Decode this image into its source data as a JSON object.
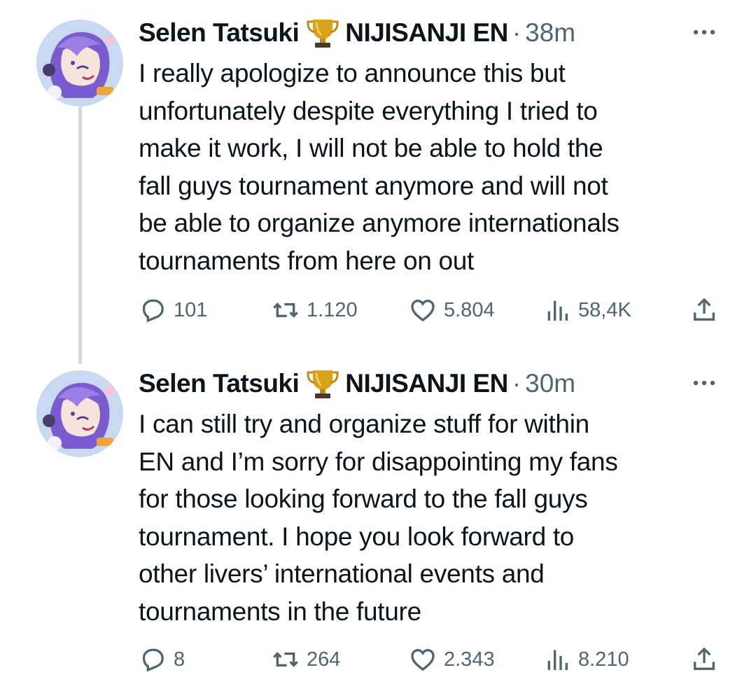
{
  "tweets": [
    {
      "display_name": "Selen Tatsuki",
      "badge_icon": "trophy-icon",
      "affiliation": "NIJISANJI EN",
      "separator": "·",
      "time": "38m",
      "text_lines": [
        "I really apologize to announce this but",
        "unfortunately despite everything I tried to",
        "make it work, I will not be able to hold the",
        "fall guys tournament anymore and will not",
        "be able to organize anymore internationals",
        "tournaments from here on out"
      ],
      "replies": "101",
      "reposts": "1.120",
      "likes": "5.804",
      "views": "58,4K"
    },
    {
      "display_name": "Selen Tatsuki",
      "badge_icon": "trophy-icon",
      "affiliation": "NIJISANJI EN",
      "separator": "·",
      "time": "30m",
      "text_lines": [
        "I can still try and organize stuff for within",
        "EN and I’m sorry for disappointing my fans",
        "for those looking forward to the fall guys",
        "tournament. I hope you look forward to",
        "other livers’ international events and",
        "tournaments in the future"
      ],
      "replies": "8",
      "reposts": "264",
      "likes": "2.343",
      "views": "8.210"
    }
  ],
  "icons": {
    "reply": "reply-icon",
    "repost": "repost-icon",
    "like": "heart-icon",
    "views": "views-icon",
    "share": "share-icon",
    "more": "more-icon"
  },
  "colors": {
    "text": "#0f1419",
    "secondary": "#536471",
    "thread_line": "#cfd9de",
    "trophy": "#d4a017"
  }
}
